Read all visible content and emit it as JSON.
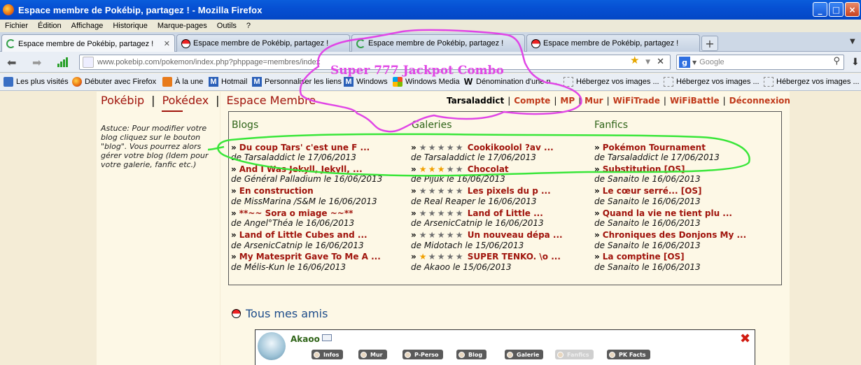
{
  "window": {
    "title": "Espace membre de Pokébip, partagez ! - Mozilla Firefox"
  },
  "menu": [
    "Fichier",
    "Édition",
    "Affichage",
    "Historique",
    "Marque-pages",
    "Outils",
    "?"
  ],
  "tabs": [
    {
      "label": "Espace membre de Pokébip, partagez !",
      "icon": "loading-icon"
    },
    {
      "label": "Espace membre de Pokébip, partagez !",
      "icon": "pokeball-icon"
    },
    {
      "label": "Espace membre de Pokébip, partagez !",
      "icon": "loading-icon"
    },
    {
      "label": "Espace membre de Pokébip, partagez !",
      "icon": "pokeball-icon"
    }
  ],
  "nav": {
    "url": "www.pokebip.com/pokemon/index.php?phppage=membres/index",
    "search_placeholder": "Google"
  },
  "bookmarks": [
    "Les plus visités",
    "Débuter avec Firefox",
    "À la une",
    "Hotmail",
    "Personnaliser les liens",
    "Windows",
    "Windows Media",
    "Dénomination d'une n...",
    "Hébergez vos images ...",
    "Hébergez vos images ...",
    "Hébergez vos images ..."
  ],
  "site": {
    "nav": [
      "Pokébip",
      "Pokédex",
      "Espace Membre"
    ],
    "user": "Tarsaladdict",
    "user_links": [
      "Compte",
      "MP",
      "Mur",
      "WiFiTrade",
      "WiFiBattle",
      "Déconnexion"
    ],
    "astuce": "Astuce: Pour modifier votre blog cliquez sur le bouton \"blog\". Vous pourrez alors gérer votre blog (Idem pour votre galerie, fanfic etc.)"
  },
  "feed": {
    "blogs": {
      "title": "Blogs",
      "items": [
        {
          "title": "Du coup Tars' c'est une F ...",
          "meta": "de Tarsaladdict le 17/06/2013"
        },
        {
          "title": "And I Was Jekyll, Jekyll, ...",
          "meta": "de Général Palladium le 16/06/2013"
        },
        {
          "title": "En construction",
          "meta": "de MissMarina /S&M le 16/06/2013"
        },
        {
          "title": "**~~ Sora o miage ~~**",
          "meta": "de Angel°Théa le 16/06/2013"
        },
        {
          "title": "Land of Little Cubes and ...",
          "meta": "de ArsenicCatnip le 16/06/2013"
        },
        {
          "title": "My Matesprit Gave To Me A ...",
          "meta": "de Mélis-Kun le 16/06/2013"
        }
      ]
    },
    "galeries": {
      "title": "Galeries",
      "items": [
        {
          "title": "Cookikoolol ?av ...",
          "meta": "de Tarsaladdict le 17/06/2013",
          "rating": 0
        },
        {
          "title": "Chocolat",
          "meta": "de Pijuk le 16/06/2013",
          "rating": 3
        },
        {
          "title": "Les pixels du p ...",
          "meta": "de Real Reaper le 16/06/2013",
          "rating": 0
        },
        {
          "title": "Land of Little ...",
          "meta": "de ArsenicCatnip le 16/06/2013",
          "rating": 0
        },
        {
          "title": "Un nouveau dépa ...",
          "meta": "de Midotach le 15/06/2013",
          "rating": 0
        },
        {
          "title": "SUPER TENKO. \\o ...",
          "meta": "de Akaoo le 15/06/2013",
          "rating": 1
        }
      ]
    },
    "fanfics": {
      "title": "Fanfics",
      "items": [
        {
          "title": "Pokémon Tournament",
          "meta": "de Tarsaladdict le 17/06/2013"
        },
        {
          "title": "Substitution [OS]",
          "meta": "de Sanaito le 16/06/2013"
        },
        {
          "title": "Le cœur serré... [OS]",
          "meta": "de Sanaito le 16/06/2013"
        },
        {
          "title": "Quand la vie ne tient plu ...",
          "meta": "de Sanaito le 16/06/2013"
        },
        {
          "title": "Chroniques des Donjons My ...",
          "meta": "de Sanaito le 16/06/2013"
        },
        {
          "title": "La comptine [OS]",
          "meta": "de Sanaito le 16/06/2013"
        }
      ]
    }
  },
  "friends": {
    "title": "Tous mes amis",
    "items": [
      {
        "name": "Akaoo",
        "buttons": [
          "Infos",
          "Mur",
          "P-Perso",
          "Blog",
          "Galerie",
          "Fanfics",
          "PK Facts"
        ]
      }
    ]
  },
  "annotation": {
    "text": "Super 777 Jackpot Combo",
    "colors": {
      "scribble": "#e045e6",
      "highlight": "#39e639"
    }
  },
  "colors": {
    "link": "#a0140c",
    "heading": "#2f6418",
    "friends": "#1d4c8a",
    "page_bg": "#f4ecd6"
  }
}
